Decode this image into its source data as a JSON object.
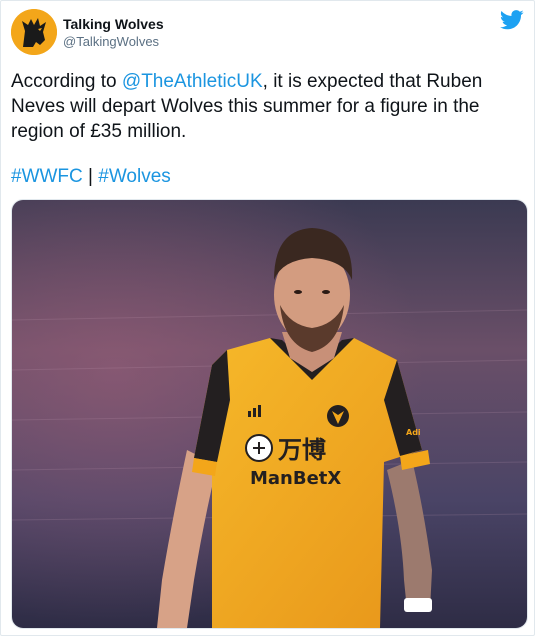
{
  "tweet": {
    "display_name": "Talking Wolves",
    "handle": "@TalkingWolves",
    "text_before": "According to ",
    "mention": "@TheAthleticUK",
    "text_after": ", it is expected that Ruben Neves will depart Wolves this summer for a figure in the region of £35 million.",
    "hashtags": [
      "#WWFC",
      "#Wolves"
    ],
    "separator": " | "
  },
  "media": {
    "shirt_brand": "ManBetX",
    "shirt_chinese": "万博",
    "sleeve_text": "Adi"
  },
  "icons": {
    "platform": "twitter-bird-icon",
    "avatar": "wolf-logo-icon"
  },
  "colors": {
    "link": "#1b95e0",
    "twitter_blue": "#1da1f2",
    "kit_gold": "#f3a61a",
    "kit_black": "#231f20"
  }
}
